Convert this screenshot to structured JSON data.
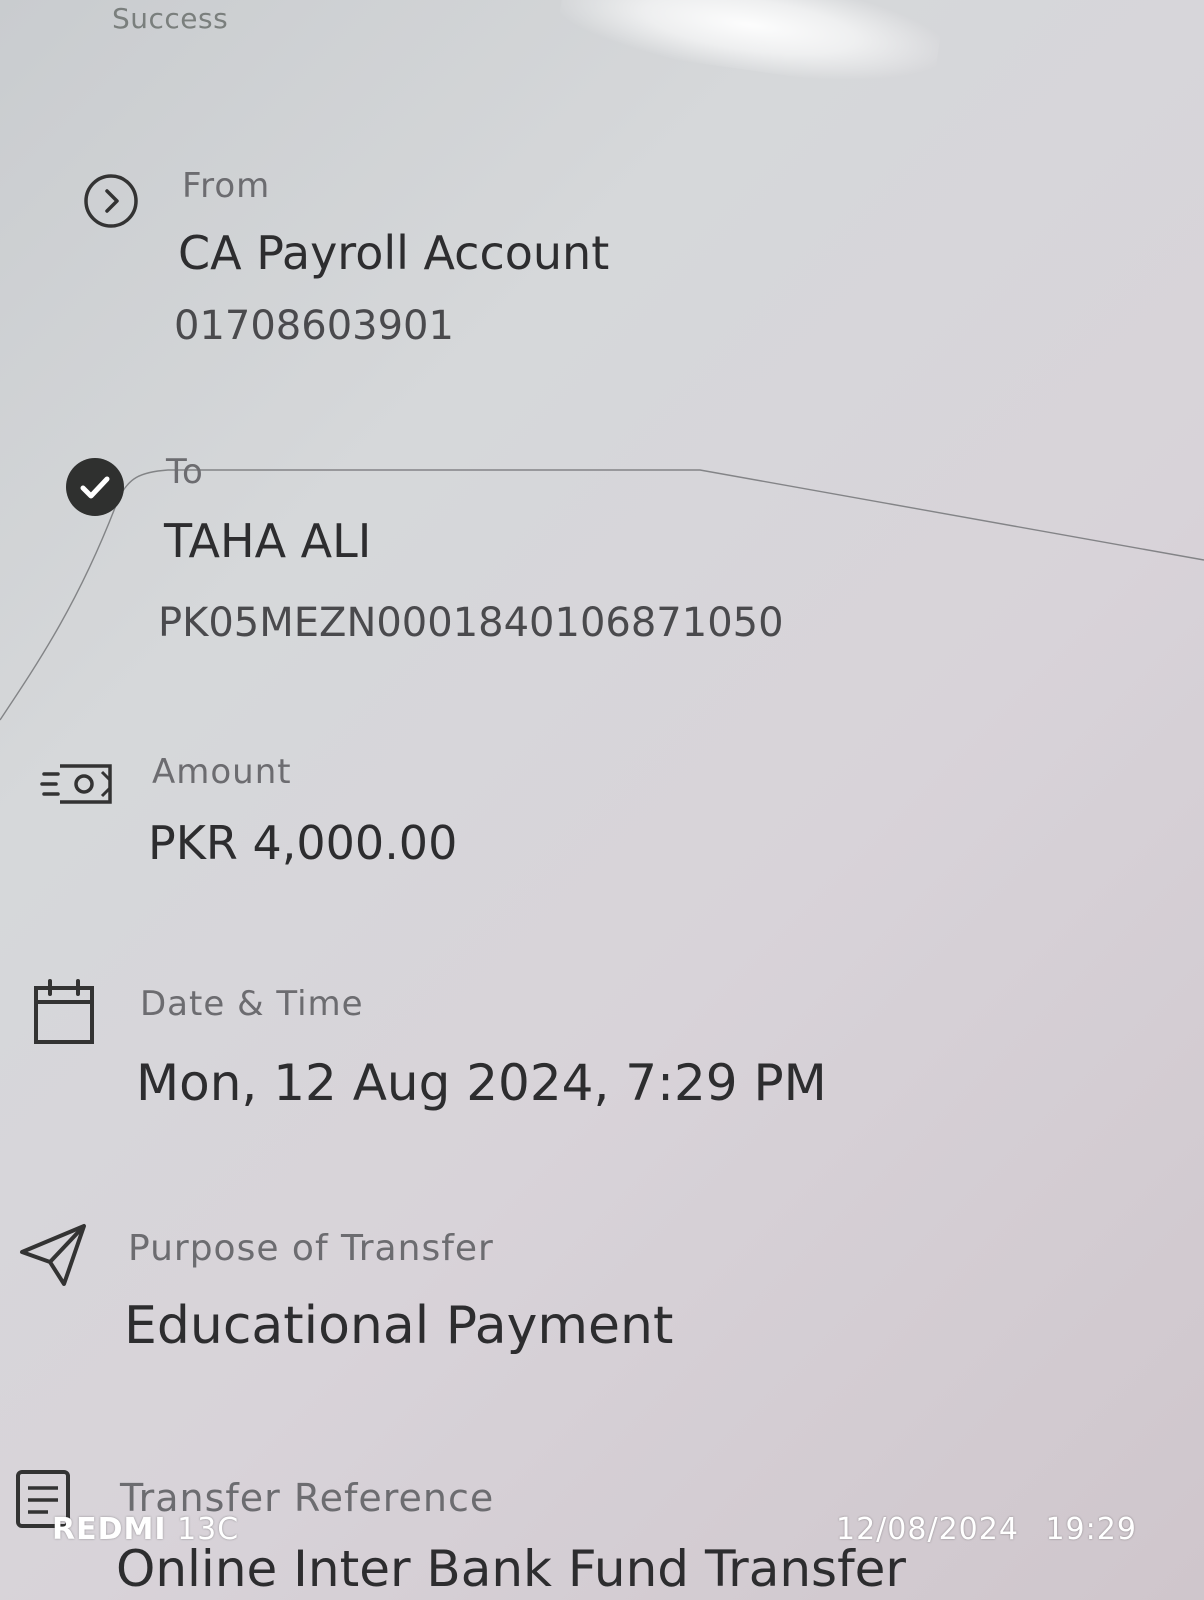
{
  "status": "Success",
  "from": {
    "label": "From",
    "account_name": "CA Payroll Account",
    "account_number": "01708603901",
    "icon": "chevron-circle-icon"
  },
  "to": {
    "label": "To",
    "name": "TAHA ALI",
    "iban": "PK05MEZN0001840106871050",
    "icon": "check-circle-icon"
  },
  "amount": {
    "label": "Amount",
    "currency": "PKR",
    "value": "4,000.00",
    "icon": "cash-icon"
  },
  "datetime": {
    "label": "Date & Time",
    "value": "Mon, 12 Aug 2024, 7:29 PM",
    "icon": "calendar-icon"
  },
  "purpose": {
    "label": "Purpose of Transfer",
    "value": "Educational Payment",
    "icon": "send-icon"
  },
  "reference": {
    "label": "Transfer Reference",
    "value_partial": "Online Inter Bank Fund Transfer",
    "icon": "document-icon"
  },
  "watermark": {
    "brand": "REDMI",
    "model": "13C",
    "date": "12/08/2024",
    "time": "19:29"
  }
}
